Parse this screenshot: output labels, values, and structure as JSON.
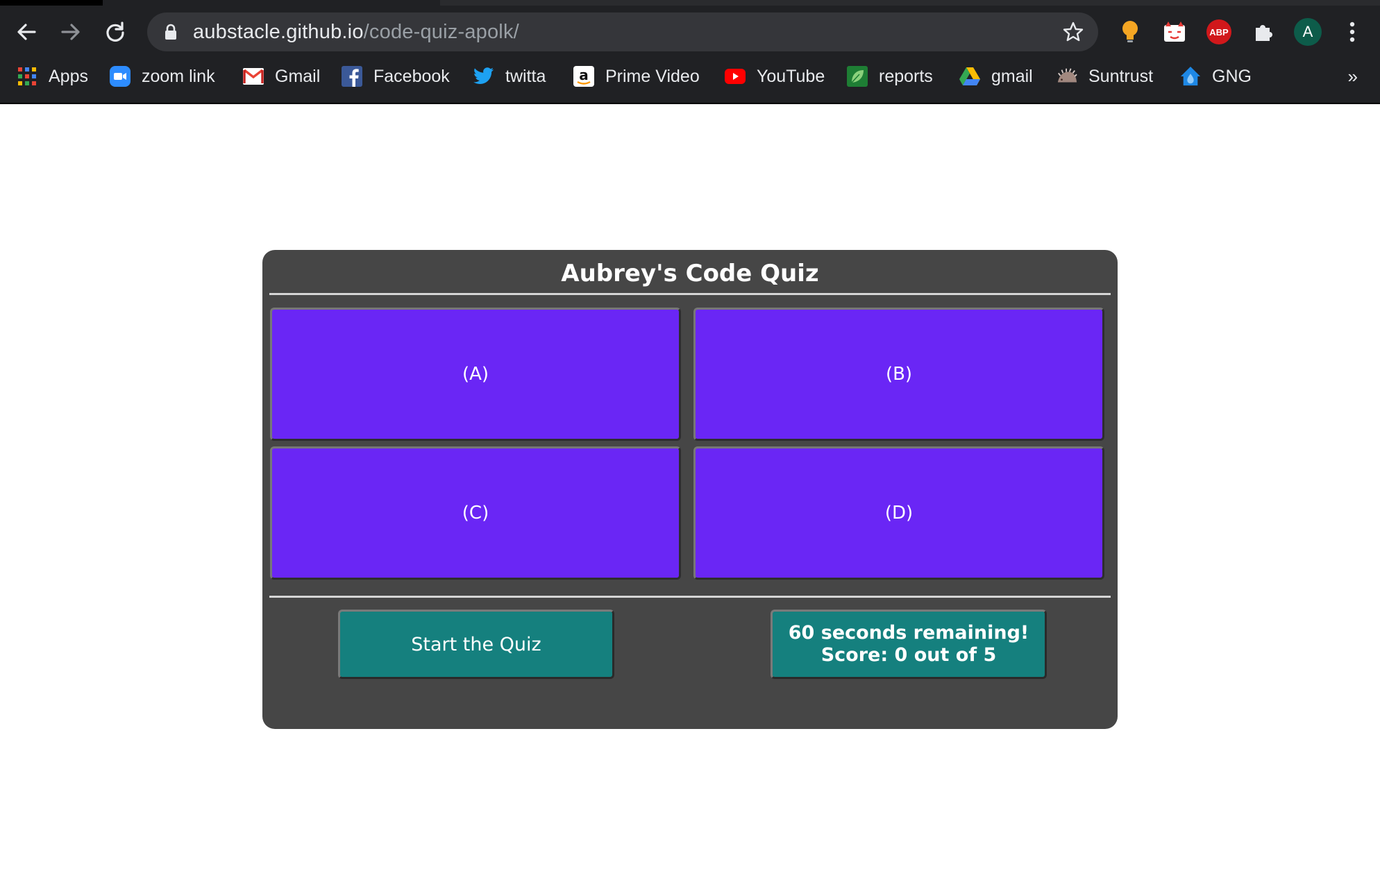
{
  "browser": {
    "url_host": "aubstacle.github.io",
    "url_path": "/code-quiz-apolk/",
    "profile_initial": "A",
    "abp_label": "ABP",
    "bookmarks": [
      {
        "label": "Apps",
        "icon": "apps-grid-icon"
      },
      {
        "label": "zoom link",
        "icon": "zoom-icon"
      },
      {
        "label": "Gmail",
        "icon": "gmail-icon"
      },
      {
        "label": "Facebook",
        "icon": "facebook-icon"
      },
      {
        "label": "twitta",
        "icon": "twitter-icon"
      },
      {
        "label": "Prime Video",
        "icon": "amazon-icon"
      },
      {
        "label": "YouTube",
        "icon": "youtube-icon"
      },
      {
        "label": "reports",
        "icon": "leaf-icon"
      },
      {
        "label": "gmail",
        "icon": "google-drive-icon"
      },
      {
        "label": "Suntrust",
        "icon": "hedgehog-icon"
      },
      {
        "label": "GNG",
        "icon": "house-drop-icon"
      }
    ],
    "more_label": "»"
  },
  "quiz": {
    "title": "Aubrey's Code Quiz",
    "answers": [
      "(A)",
      "(B)",
      "(C)",
      "(D)"
    ],
    "start_label": "Start the Quiz",
    "status_line1": "60 seconds remaining!",
    "status_line2": "Score: 0 out of 5"
  },
  "colors": {
    "card": "#464646",
    "answer": "#6a26f5",
    "action": "#15807e",
    "chrome": "#202124"
  }
}
